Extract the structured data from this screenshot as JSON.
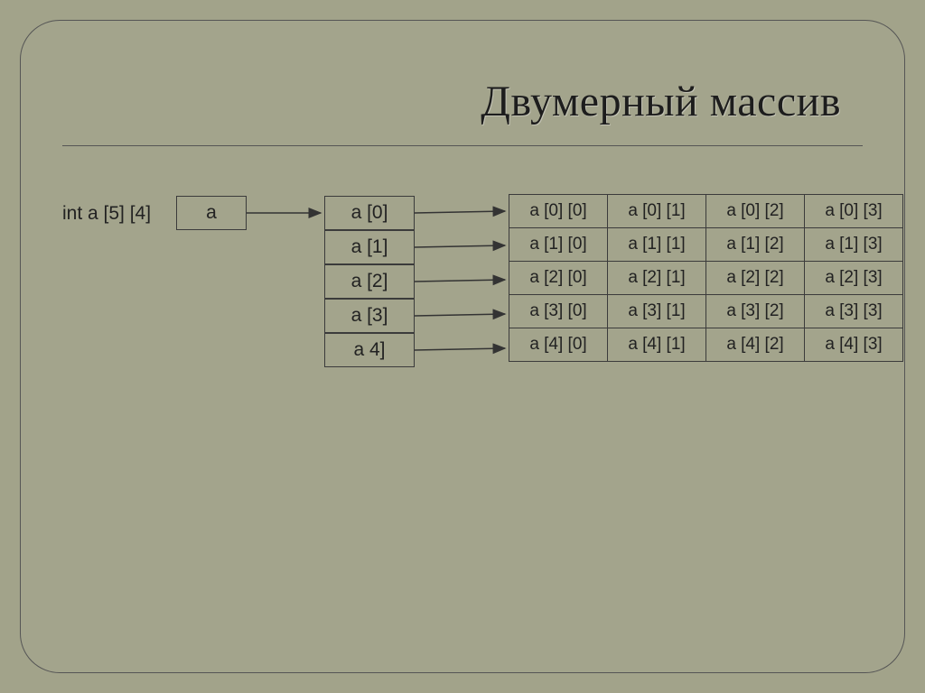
{
  "title": "Двумерный массив",
  "declaration": "int a [5] [4]",
  "pointer_label": "a",
  "rows": {
    "0": "a [0]",
    "1": "a [1]",
    "2": "a [2]",
    "3": "a [3]",
    "4": "a 4]"
  },
  "grid": [
    [
      "a [0] [0]",
      "a [0] [1]",
      "a [0] [2]",
      "a [0] [3]"
    ],
    [
      "a [1] [0]",
      "a [1] [1]",
      "a [1] [2]",
      "a [1] [3]"
    ],
    [
      "a [2] [0]",
      "a [2] [1]",
      "a [2] [2]",
      "a [2] [3]"
    ],
    [
      "a [3] [0]",
      "a [3] [1]",
      "a [3] [2]",
      "a [3] [3]"
    ],
    [
      "a [4] [0]",
      "a [4] [1]",
      "a [4] [2]",
      "a [4] [3]"
    ]
  ]
}
